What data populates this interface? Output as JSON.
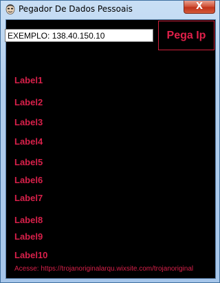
{
  "window": {
    "title": "Pegador De Dados Pessoais",
    "close_label": "X"
  },
  "form": {
    "ip_input_value": "EXEMPLO: 138.40.150.10",
    "get_ip_label": "Pega Ip"
  },
  "labels": [
    "Label1",
    "Label2",
    "Label3",
    "Label4",
    "Label5",
    "Label6",
    "Label7",
    "Label8",
    "Label9",
    "Label10"
  ],
  "footer": {
    "text": "Acesse: https://trojanoriginalarqu.wixsite.com/trojanoriginal"
  },
  "colors": {
    "accent": "#d8204a",
    "background": "#000000"
  },
  "icons": {
    "app": "face-icon",
    "close": "close-icon"
  }
}
